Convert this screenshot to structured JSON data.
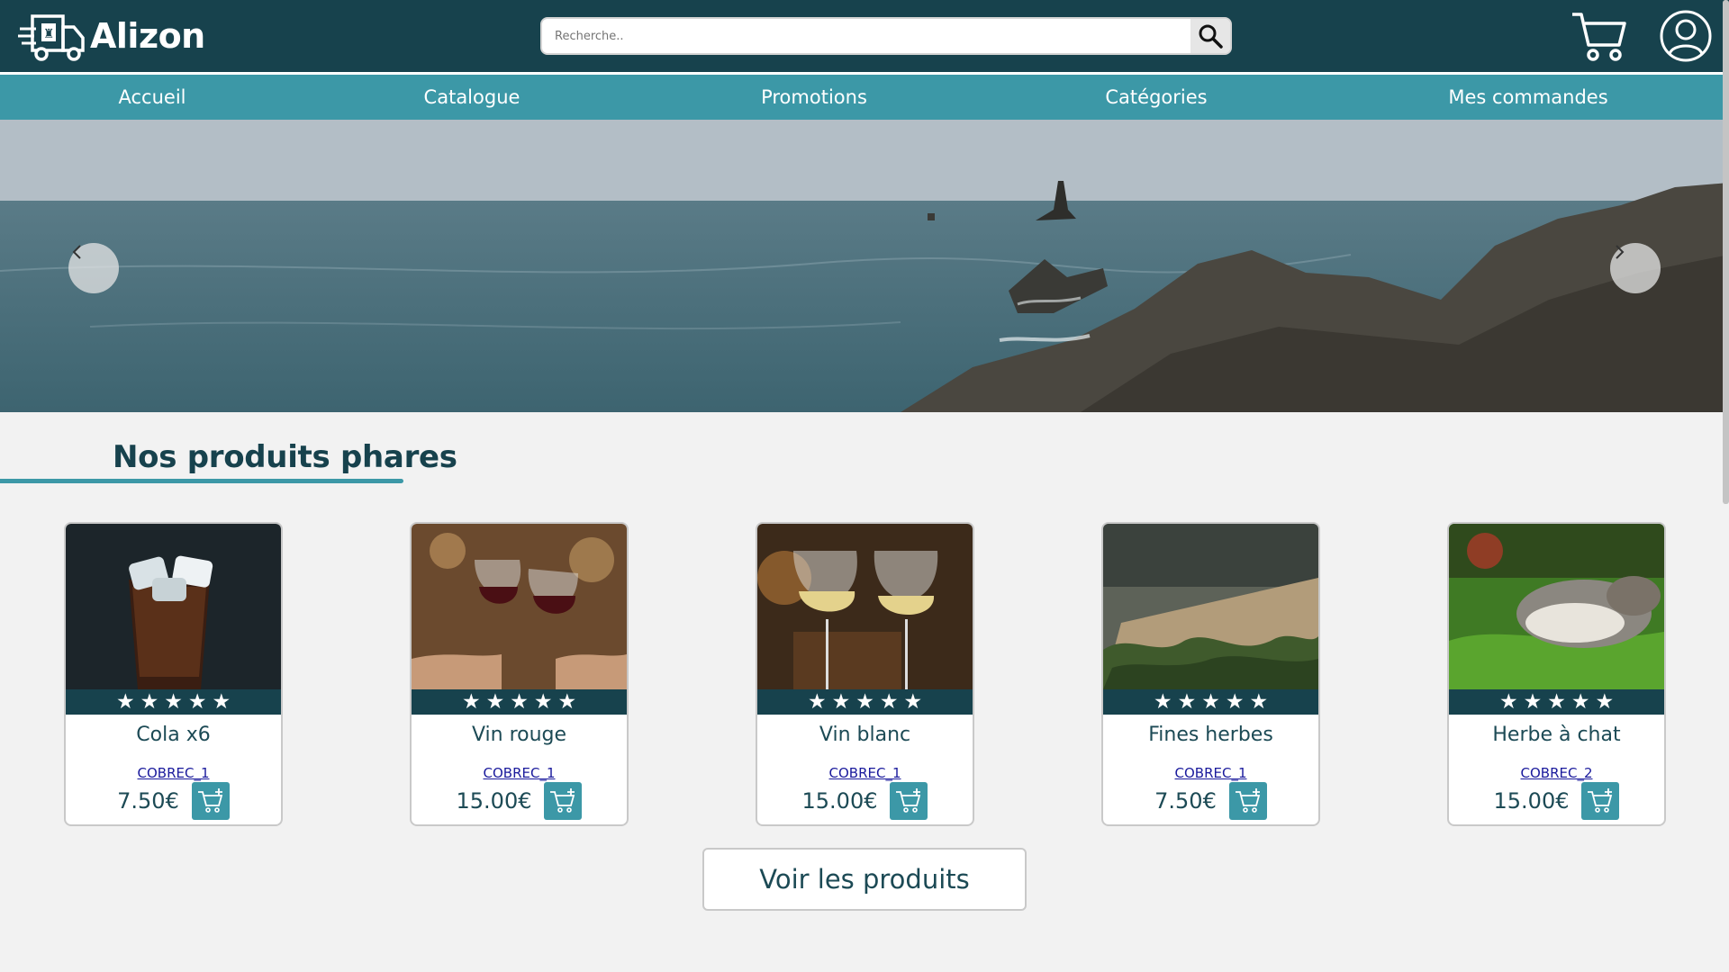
{
  "header": {
    "brand": "Alizon",
    "search": {
      "placeholder": "Recherche..",
      "value": ""
    },
    "icons": {
      "logo": "delivery-truck-icon",
      "search": "search-icon",
      "cart": "cart-icon",
      "user": "user-icon"
    }
  },
  "nav": {
    "items": [
      {
        "label": "Accueil"
      },
      {
        "label": "Catalogue"
      },
      {
        "label": "Promotions"
      },
      {
        "label": "Catégories"
      },
      {
        "label": "Mes commandes"
      }
    ]
  },
  "hero": {
    "prev_icon": "chevron-left-icon",
    "next_icon": "chevron-right-icon"
  },
  "featured": {
    "title": "Nos produits phares",
    "products": [
      {
        "name": "Cola x6",
        "seller": "COBREC_1",
        "price": "7.50€",
        "rating": 5
      },
      {
        "name": "Vin rouge",
        "seller": "COBREC_1",
        "price": "15.00€",
        "rating": 5
      },
      {
        "name": "Vin blanc",
        "seller": "COBREC_1",
        "price": "15.00€",
        "rating": 5
      },
      {
        "name": "Fines herbes",
        "seller": "COBREC_1",
        "price": "7.50€",
        "rating": 5
      },
      {
        "name": "Herbe à chat",
        "seller": "COBREC_2",
        "price": "15.00€",
        "rating": 5
      }
    ],
    "view_all_label": "Voir les produits"
  },
  "colors": {
    "header_bg": "#17424d",
    "nav_bg": "#3c98a7",
    "accent": "#3c98a7",
    "text": "#1c4a55"
  }
}
